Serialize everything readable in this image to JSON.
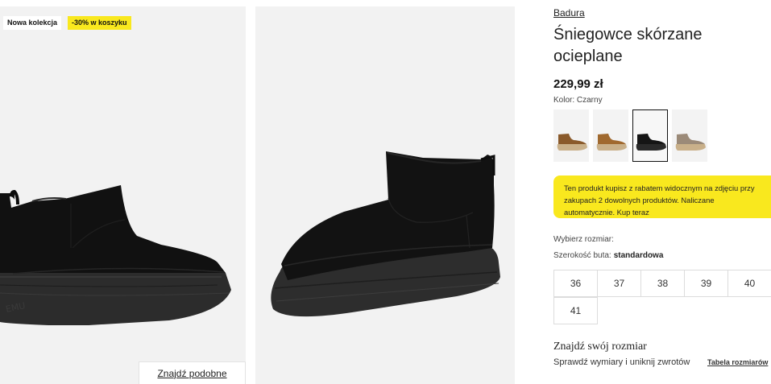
{
  "badges": {
    "new_collection": "Nowa kolekcja",
    "discount": "-30% w koszyku"
  },
  "gallery": {
    "similar_button": "Znajdź podobne"
  },
  "product": {
    "brand": "Badura",
    "title": "Śniegowce skórzane ocieplane",
    "price": "229,99 zł",
    "color_label": "Kolor: Czarny",
    "swatches": [
      {
        "color": "#8a5a2b",
        "selected": false
      },
      {
        "color": "#a0692f",
        "selected": false
      },
      {
        "color": "#151515",
        "selected": true
      },
      {
        "color": "#9b8a78",
        "selected": false
      }
    ]
  },
  "promo": {
    "text": "Ten produkt kupisz z rabatem widocznym na zdjęciu przy zakupach 2 dowolnych produktów. Naliczane automatycznie. Kup teraz"
  },
  "size": {
    "choose_label": "Wybierz rozmiar:",
    "width_label": "Szerokość buta:",
    "width_value": "standardowa",
    "options": [
      "36",
      "37",
      "38",
      "39",
      "40",
      "41"
    ]
  },
  "fit": {
    "heading": "Znajdź swój rozmiar",
    "subtext": "Sprawdź wymiary i uniknij zwrotów",
    "table_link": "Tabela rozmiarów"
  },
  "colors": {
    "accent_yellow": "#f9e81e",
    "panel_bg": "#f2f2f2"
  }
}
